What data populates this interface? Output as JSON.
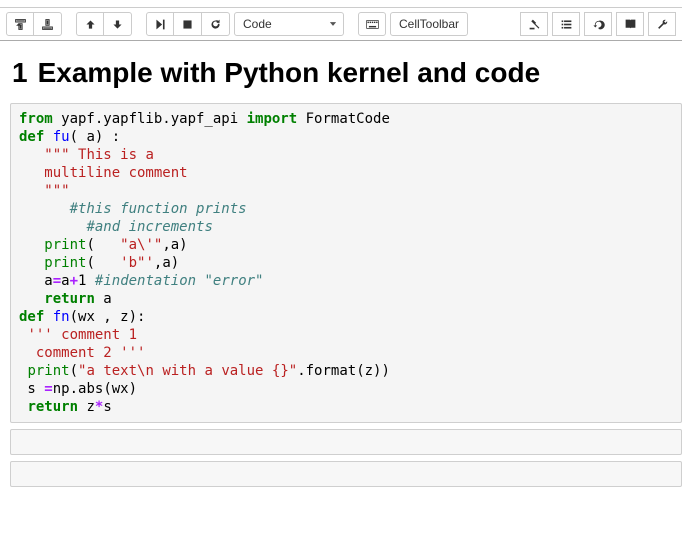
{
  "toolbar": {
    "cell_type_selected": "Code",
    "cell_toolbar_label": "CellToolbar"
  },
  "heading": {
    "number": "1",
    "text": "Example with Python kernel and code"
  },
  "code": {
    "l1a": "from",
    "l1b": " yapf.yapflib.yapf_api ",
    "l1c": "import",
    "l1d": " FormatCode",
    "l2a": "def",
    "l2b": " ",
    "l2c": "fu",
    "l2d": "( a) :",
    "l3a": "   ",
    "l3b": "\"\"\" This is a",
    "l4a": "   multiline comment",
    "l5a": "   \"\"\"",
    "l6a": "      ",
    "l6b": "#this function prints",
    "l7a": "        ",
    "l7b": "#and increments",
    "l8a": "   ",
    "l8b": "print",
    "l8c": "(   ",
    "l8d": "\"a\\'\"",
    "l8e": ",a)",
    "l9a": "   ",
    "l9b": "print",
    "l9c": "(   ",
    "l9d": "'b\"'",
    "l9e": ",a)",
    "l10a": "   a",
    "l10b": "=",
    "l10c": "a",
    "l10d": "+",
    "l10e": "1",
    "l10f": " ",
    "l10g": "#indentation \"error\"",
    "l11a": "   ",
    "l11b": "return",
    "l11c": " a",
    "l12a": "def",
    "l12b": " ",
    "l12c": "fn",
    "l12d": "(wx , z):",
    "l13a": " ",
    "l13b": "''' comment 1",
    "l14a": "  comment 2 '''",
    "l15a": " ",
    "l15b": "print",
    "l15c": "(",
    "l15d": "\"a text\\n with a value {}\"",
    "l15e": ".",
    "l15f": "format",
    "l15g": "(z))",
    "l16a": " s ",
    "l16b": "=",
    "l16c": "np",
    "l16d": ".",
    "l16e": "abs(wx)",
    "l17a": " ",
    "l17b": "return",
    "l17c": " z",
    "l17d": "*",
    "l17e": "s"
  }
}
